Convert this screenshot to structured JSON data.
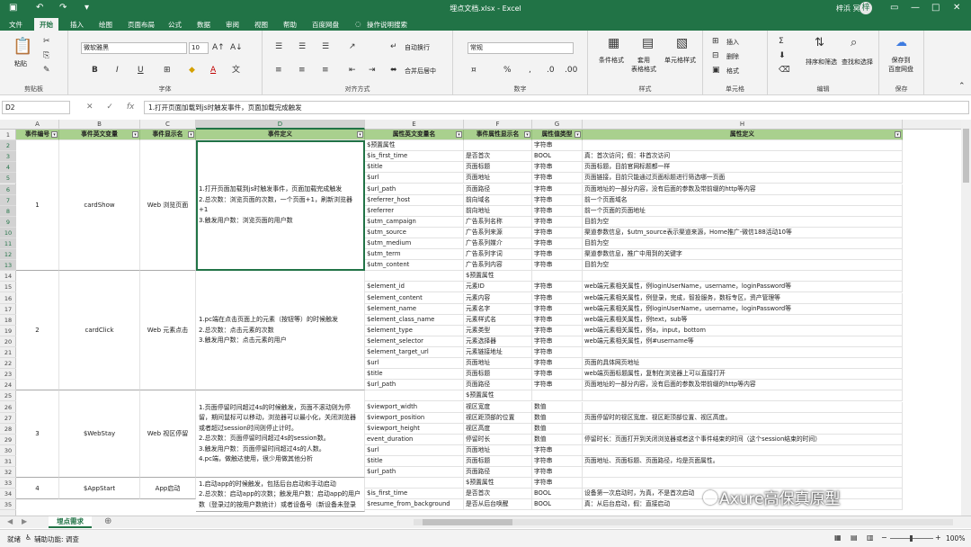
{
  "title": "埋点文档.xlsx - Excel",
  "user": "梓浜 冥",
  "user_initial": "梓",
  "tabs": [
    "文件",
    "开始",
    "插入",
    "绘图",
    "页面布局",
    "公式",
    "数据",
    "审阅",
    "视图",
    "帮助",
    "百度网盘",
    "操作说明搜索"
  ],
  "ribbon": {
    "groups": [
      "剪贴板",
      "字体",
      "对齐方式",
      "数字",
      "样式",
      "单元格",
      "编辑",
      "保存"
    ],
    "paste": "粘贴",
    "font_name": "微软雅黑",
    "font_size": "10",
    "wrap": "自动换行",
    "merge": "合并后居中",
    "number_format": "常规",
    "cond_format": "条件格式",
    "table_format": "套用\n表格格式",
    "cell_style": "单元格样式",
    "insert": "插入",
    "delete": "删除",
    "format": "格式",
    "sort": "排序和筛选",
    "find": "查找和选择",
    "save_baidu": "保存到\n百度网盘"
  },
  "formula": {
    "cell": "D2",
    "fx": "fx",
    "content": "1.打开页面加载到js时触发事件，页面加载完成触发"
  },
  "col_letters": [
    "A",
    "B",
    "C",
    "D",
    "E",
    "F",
    "G",
    "H"
  ],
  "headers": [
    "事件编号",
    "事件英文变量",
    "事件显示名",
    "事件定义",
    "属性英文变量名",
    "事件属性显示名",
    "属性值类型",
    "属性定义"
  ],
  "events": [
    {
      "id": "1",
      "var": "cardShow",
      "name": "Web 浏览页面",
      "def": "1.打开页面加载到js时触发事件，页面加载完成触发\n2.总次数：浏览页面的次数，一个页面+1，刷新浏览器+1\n3.触发用户数：浏览页面的用户数"
    },
    {
      "id": "2",
      "var": "cardClick",
      "name": "Web 元素点击",
      "def": "1.pc端在点击页面上的元素（按钮等）的时候触发\n2.总次数：点击元素的次数\n3.触发用户数：点击元素的用户"
    },
    {
      "id": "3",
      "var": "$WebStay",
      "name": "Web 视区停留",
      "def": "1.页面停留时间超过4s的时候触发，页面不滚动则为停留，期间鼠标可以移动，浏览器可以最小化，关闭浏览器或者超过session时间则停止计时。\n2.总次数：页面停留时间超过4s的session数。\n3.触发用户数：页面停留时间超过4s的人数。\n4.pc端，做触达使用，很少用做其他分析"
    },
    {
      "id": "4",
      "var": "$AppStart",
      "name": "App启动",
      "def": "1.启动app的时候触发，包括后台启动和手动启动\n2.总次数：启动app的次数；触发用户数：启动app的用户数（登录过的按用户数统计）或者设备号（新设备未登录"
    }
  ],
  "rows": [
    [
      "$预置属性",
      "",
      "字符串",
      ""
    ],
    [
      "$is_first_time",
      "是否首次",
      "BOOL",
      "真：首次访问；假：非首次访问"
    ],
    [
      "$title",
      "页面标题",
      "字符串",
      "页面标题，目前官网标题都一样"
    ],
    [
      "$url",
      "页面地址",
      "字符串",
      "页面链接，目前只能通过页面标题进行筛选哪一页面"
    ],
    [
      "$url_path",
      "页面路径",
      "字符串",
      "页面地址的一部分内容，没有后面的参数及带前缀的http等内容"
    ],
    [
      "$referrer_host",
      "前向域名",
      "字符串",
      "前一个页面域名"
    ],
    [
      "$referrer",
      "前向地址",
      "字符串",
      "前一个页面的页面地址"
    ],
    [
      "$utm_campaign",
      "广告系列名称",
      "字符串",
      "目前为空"
    ],
    [
      "$utm_source",
      "广告系列来源",
      "字符串",
      "渠道参数信息，$utm_source表示渠道来源，Home推广-微信188活动10等"
    ],
    [
      "$utm_medium",
      "广告系列媒介",
      "字符串",
      "目前为空"
    ],
    [
      "$utm_term",
      "广告系列字词",
      "字符串",
      "渠道参数信息，推广中用到的关键字"
    ],
    [
      "$utm_content",
      "广告系列内容",
      "字符串",
      "目前为空"
    ],
    [
      "",
      "$预置属性",
      "",
      ""
    ],
    [
      "$element_id",
      "元素ID",
      "字符串",
      "web端元素相关属性，例loginUserName，username，loginPassword等"
    ],
    [
      "$element_content",
      "元素内容",
      "字符串",
      "web端元素相关属性，例登录，完成，智投服务，数标专区，资产管理等"
    ],
    [
      "$element_name",
      "元素名字",
      "字符串",
      "web端元素相关属性，例loginUserName，username，loginPassword等"
    ],
    [
      "$element_class_name",
      "元素样式名",
      "字符串",
      "web端元素相关属性，例text，sub等"
    ],
    [
      "$element_type",
      "元素类型",
      "字符串",
      "web端元素相关属性，例a，input，bottom"
    ],
    [
      "$element_selector",
      "元素选择器",
      "字符串",
      "web端元素相关属性，例#username等"
    ],
    [
      "$element_target_url",
      "元素链接地址",
      "字符串",
      ""
    ],
    [
      "$url",
      "页面地址",
      "字符串",
      "页面的具体网页地址"
    ],
    [
      "$title",
      "页面标题",
      "字符串",
      "web端页面标题属性，复制在浏览器上可以直接打开"
    ],
    [
      "$url_path",
      "页面路径",
      "字符串",
      "页面地址的一部分内容，没有后面的参数及带前缀的http等内容"
    ],
    [
      "",
      "$预置属性",
      "",
      ""
    ],
    [
      "$viewport_width",
      "视区宽度",
      "数值",
      ""
    ],
    [
      "$viewport_position",
      "视区距顶部的位置",
      "数值",
      "页面停留时的视区宽度、视区距顶部位置、视区高度。"
    ],
    [
      "$viewport_height",
      "视区高度",
      "数值",
      ""
    ],
    [
      "event_duration",
      "停留时长",
      "数值",
      "停留时长：页面打开到关闭浏览器或者这个事件结束的时间（这个session结束的时间）"
    ],
    [
      "$url",
      "页面地址",
      "字符串",
      ""
    ],
    [
      "$title",
      "页面标题",
      "字符串",
      "页面地址、页面标题、页面路径，均是页面属性。"
    ],
    [
      "$url_path",
      "页面路径",
      "字符串",
      ""
    ],
    [
      "",
      "$预置属性",
      "字符串",
      ""
    ],
    [
      "$is_first_time",
      "是否首次",
      "BOOL",
      "设备第一次启动时，为真，不是首次启动"
    ],
    [
      "$resume_from_background",
      "是否从后台唤醒",
      "BOOL",
      "真：从后台启动，假：直接启动"
    ]
  ],
  "sheet_tab": "埋点需求",
  "status": {
    "ready": "就绪",
    "access": "辅助功能: 调查",
    "zoom": "100%"
  },
  "watermark": "Axure高保真原型"
}
